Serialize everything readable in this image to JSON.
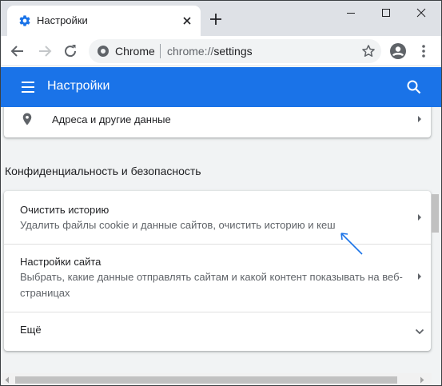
{
  "tab": {
    "title": "Настройки"
  },
  "omnibox": {
    "site_label": "Chrome",
    "url_scheme": "chrome://",
    "url_path": "settings"
  },
  "header": {
    "title": "Настройки"
  },
  "rows": {
    "addresses": {
      "label": "Адреса и другие данные"
    },
    "section_title": "Конфиденциальность и безопасность",
    "clear_history": {
      "title": "Очистить историю",
      "subtitle": "Удалить файлы cookie и данные сайтов, очистить историю и кеш"
    },
    "site_settings": {
      "title": "Настройки сайта",
      "subtitle": "Выбрать, какие данные отправлять сайтам и какой контент показывать на веб-страницах"
    },
    "more": {
      "label": "Ещё"
    }
  },
  "colors": {
    "accent": "#1a73e8",
    "annotation": "#1a73e8",
    "background": "#f1f3f4"
  },
  "icons": [
    "gear-icon",
    "close-icon",
    "plus-icon",
    "minimize-icon",
    "maximize-icon",
    "back-icon",
    "forward-icon",
    "reload-icon",
    "info-icon",
    "star-icon",
    "account-icon",
    "menu-icon",
    "search-icon",
    "location-pin-icon",
    "chevron-right-icon",
    "chevron-down-icon"
  ]
}
